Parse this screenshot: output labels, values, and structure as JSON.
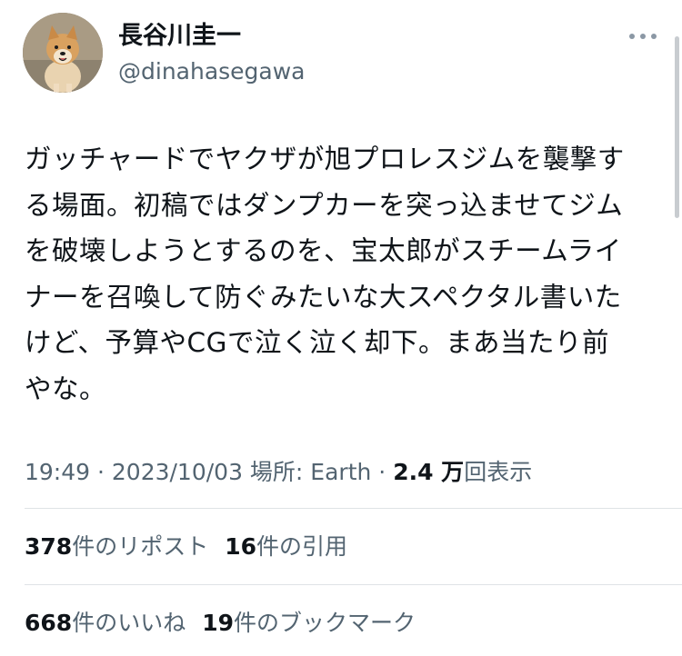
{
  "author": {
    "display_name": "長谷川圭一",
    "handle": "@dinahasegawa"
  },
  "tweet": {
    "text_lines": [
      "ガッチャードでヤクザが旭プロレスジムを襲撃す",
      "る場面。初稿ではダンプカーを突っ込ませてジム",
      "を破壊しようとするのを、宝太郎がスチームライ",
      "ナーを召喚して防ぐみたいな大スペクタル書いた",
      "けど、予算やCGで泣く泣く却下。まあ当たり前",
      "やな。"
    ]
  },
  "meta": {
    "time": "19:49",
    "sep1": " · ",
    "date": "2023/10/03",
    "location": " 場所: Earth",
    "sep2": " · ",
    "views_count": "2.4 万",
    "views_label": "回表示"
  },
  "stats_row1": [
    {
      "count": "378",
      "label": "件のリポスト"
    },
    {
      "count": "16",
      "label": "件の引用"
    }
  ],
  "stats_row2": [
    {
      "count": "668",
      "label": "件のいいね"
    },
    {
      "count": "19",
      "label": "件のブックマーク"
    }
  ],
  "icons": {
    "more": "more-horizontal-icon",
    "avatar": "shiba-dog-photo"
  },
  "colors": {
    "text": "#0f1419",
    "secondary": "#536471",
    "divider": "#dfe3e6"
  }
}
